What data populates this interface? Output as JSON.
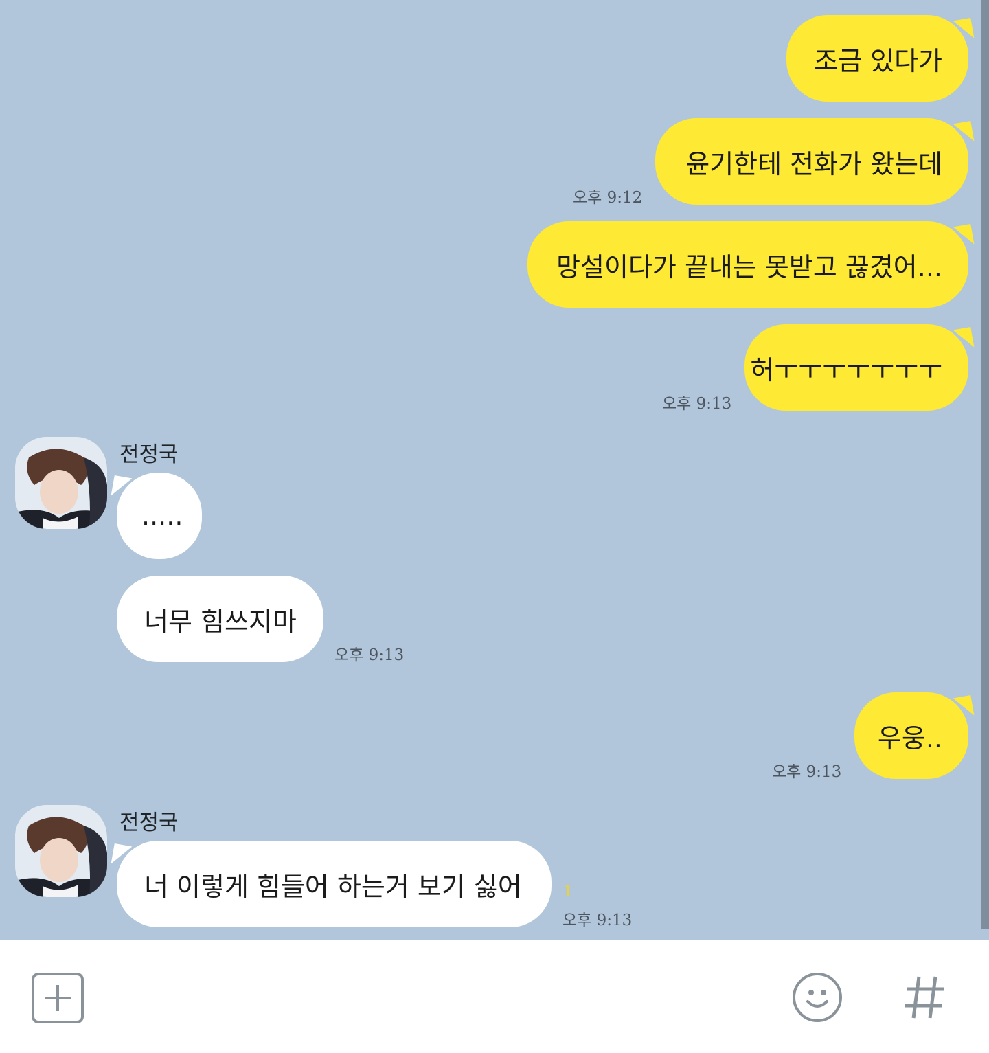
{
  "contact": {
    "name": "전정국"
  },
  "messages": [
    {
      "from": "me",
      "text": "조금 있다가"
    },
    {
      "from": "me",
      "text": "윤기한테 전화가 왔는데",
      "time": "오후 9:12"
    },
    {
      "from": "me",
      "text": "망설이다가 끝내는 못받고 끊겼어..."
    },
    {
      "from": "me",
      "text": "허ㅜㅜㅜㅜㅜㅜㅜ",
      "time": "오후 9:13"
    },
    {
      "from": "other",
      "sender": "전정국",
      "text": "....."
    },
    {
      "from": "other",
      "text": "너무 힘쓰지마",
      "time": "오후 9:13"
    },
    {
      "from": "me",
      "text": "우웅..",
      "time": "오후 9:13"
    },
    {
      "from": "other",
      "sender": "전정국",
      "text": "너 이렇게 힘들어 하는거 보기 싫어",
      "time": "오후 9:13",
      "unread": "1"
    }
  ],
  "input_bar": {
    "icons": [
      "plus-icon",
      "emoji-icon",
      "hashtag-icon"
    ]
  },
  "colors": {
    "chat_background": "#b1c6da",
    "my_bubble": "#fee935",
    "other_bubble": "#ffffff",
    "unread_count": "#e8d33b",
    "icon_gray": "#8a929a"
  }
}
